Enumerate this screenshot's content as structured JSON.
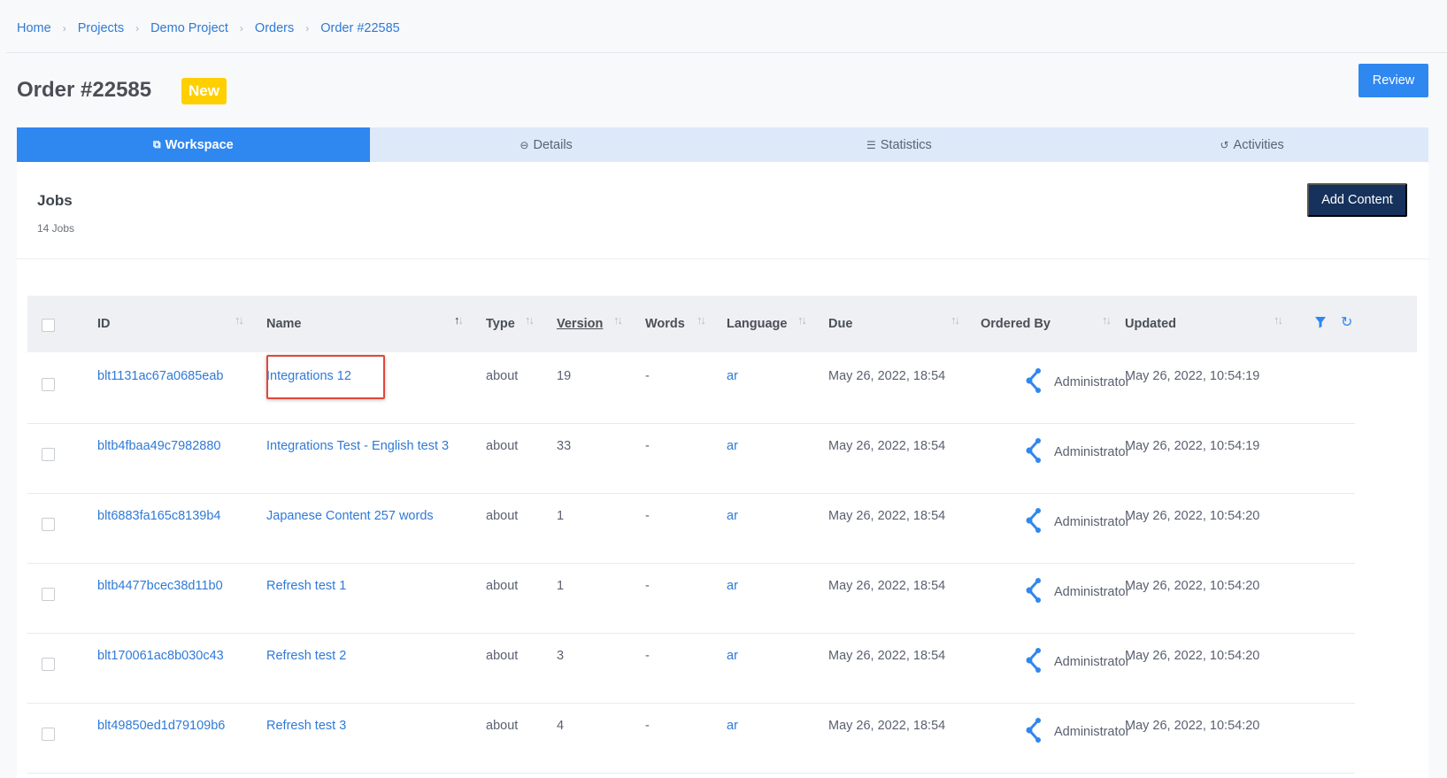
{
  "breadcrumb": [
    "Home",
    "Projects",
    "Demo Project",
    "Orders",
    "Order #22585"
  ],
  "breadcrumb_sep": "›",
  "order": {
    "title": "Order #22585",
    "status": "New"
  },
  "review_label": "Review",
  "tabs": [
    {
      "label": "Workspace",
      "icon": "workspace-icon",
      "glyph": "⧉"
    },
    {
      "label": "Details",
      "icon": "details-icon",
      "glyph": "⊖"
    },
    {
      "label": "Statistics",
      "icon": "statistics-icon",
      "glyph": "☰"
    },
    {
      "label": "Activities",
      "icon": "activities-icon",
      "glyph": "↺"
    }
  ],
  "jobs": {
    "title": "Jobs",
    "count": "14 Jobs",
    "add_label": "Add Content"
  },
  "table": {
    "columns": [
      "ID",
      "Name",
      "Type",
      "Version",
      "Words",
      "Language",
      "Due",
      "Ordered By",
      "Updated"
    ],
    "rows": [
      {
        "id": "blt1131ac67a0685eab",
        "name": "Integrations 12",
        "type": "about",
        "version": "19",
        "words": "-",
        "language": "ar",
        "due": "May 26, 2022, 18:54",
        "ordered_by": "Administrator",
        "updated": "May 26, 2022, 10:54:19"
      },
      {
        "id": "bltb4fbaa49c7982880",
        "name": "Integrations Test - English test 3",
        "type": "about",
        "version": "33",
        "words": "-",
        "language": "ar",
        "due": "May 26, 2022, 18:54",
        "ordered_by": "Administrator",
        "updated": "May 26, 2022, 10:54:19"
      },
      {
        "id": "blt6883fa165c8139b4",
        "name": "Japanese Content 257 words",
        "type": "about",
        "version": "1",
        "words": "-",
        "language": "ar",
        "due": "May 26, 2022, 18:54",
        "ordered_by": "Administrator",
        "updated": "May 26, 2022, 10:54:20"
      },
      {
        "id": "bltb4477bcec38d11b0",
        "name": "Refresh test 1",
        "type": "about",
        "version": "1",
        "words": "-",
        "language": "ar",
        "due": "May 26, 2022, 18:54",
        "ordered_by": "Administrator",
        "updated": "May 26, 2022, 10:54:20"
      },
      {
        "id": "blt170061ac8b030c43",
        "name": "Refresh test 2",
        "type": "about",
        "version": "3",
        "words": "-",
        "language": "ar",
        "due": "May 26, 2022, 18:54",
        "ordered_by": "Administrator",
        "updated": "May 26, 2022, 10:54:20"
      },
      {
        "id": "blt49850ed1d79109b6",
        "name": "Refresh test 3",
        "type": "about",
        "version": "4",
        "words": "-",
        "language": "ar",
        "due": "May 26, 2022, 18:54",
        "ordered_by": "Administrator",
        "updated": "May 26, 2022, 10:54:20"
      }
    ]
  },
  "colors": {
    "accent": "#2f87f0",
    "badge": "#ffcf00",
    "dark_button": "#16325c",
    "highlight": "#e0463a"
  }
}
